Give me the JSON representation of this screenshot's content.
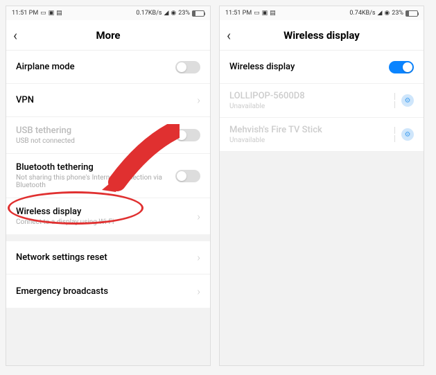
{
  "status": {
    "time": "11:51 PM",
    "net_speed_left": "0.17KB/s",
    "net_speed_right": "0.74KB/s",
    "battery_pct": "23%"
  },
  "left": {
    "title": "More",
    "rows": {
      "airplane": "Airplane mode",
      "vpn": "VPN",
      "usb_t": "USB tethering",
      "usb_t_sub": "USB not connected",
      "bt_t": "Bluetooth tethering",
      "bt_t_sub": "Not sharing this phone's Internet connection via Bluetooth",
      "wd": "Wireless display",
      "wd_sub": "Connect to a display using Wi-Fi",
      "netreset": "Network settings reset",
      "emergency": "Emergency broadcasts"
    }
  },
  "right": {
    "title": "Wireless display",
    "toggle_label": "Wireless display",
    "devices": [
      {
        "name": "LOLLIPOP-5600D8",
        "status": "Unavailable"
      },
      {
        "name": "Mehvish's Fire TV Stick",
        "status": "Unavailable"
      }
    ]
  }
}
